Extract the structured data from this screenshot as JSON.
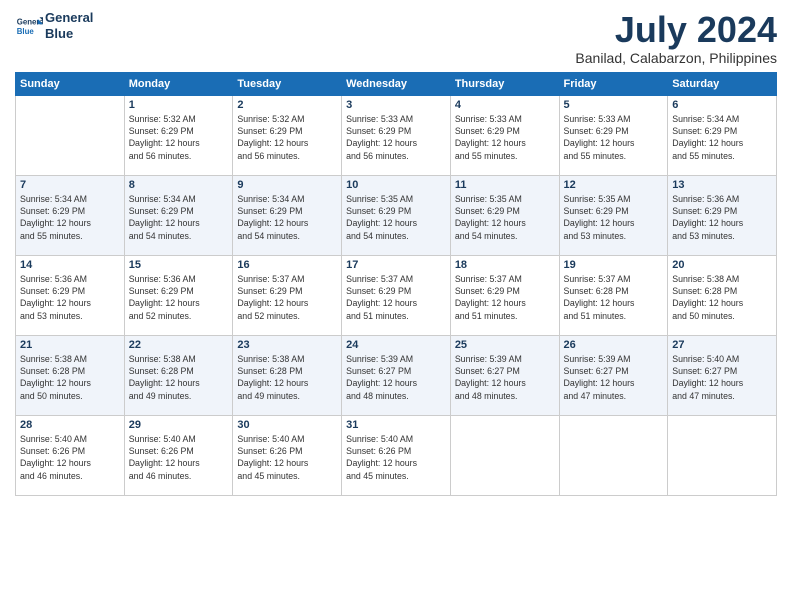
{
  "header": {
    "logo_line1": "General",
    "logo_line2": "Blue",
    "month_year": "July 2024",
    "location": "Banilad, Calabarzon, Philippines"
  },
  "weekdays": [
    "Sunday",
    "Monday",
    "Tuesday",
    "Wednesday",
    "Thursday",
    "Friday",
    "Saturday"
  ],
  "weeks": [
    [
      {
        "day": null,
        "info": null
      },
      {
        "day": "1",
        "info": "Sunrise: 5:32 AM\nSunset: 6:29 PM\nDaylight: 12 hours\nand 56 minutes."
      },
      {
        "day": "2",
        "info": "Sunrise: 5:32 AM\nSunset: 6:29 PM\nDaylight: 12 hours\nand 56 minutes."
      },
      {
        "day": "3",
        "info": "Sunrise: 5:33 AM\nSunset: 6:29 PM\nDaylight: 12 hours\nand 56 minutes."
      },
      {
        "day": "4",
        "info": "Sunrise: 5:33 AM\nSunset: 6:29 PM\nDaylight: 12 hours\nand 55 minutes."
      },
      {
        "day": "5",
        "info": "Sunrise: 5:33 AM\nSunset: 6:29 PM\nDaylight: 12 hours\nand 55 minutes."
      },
      {
        "day": "6",
        "info": "Sunrise: 5:34 AM\nSunset: 6:29 PM\nDaylight: 12 hours\nand 55 minutes."
      }
    ],
    [
      {
        "day": "7",
        "info": "Sunrise: 5:34 AM\nSunset: 6:29 PM\nDaylight: 12 hours\nand 55 minutes."
      },
      {
        "day": "8",
        "info": "Sunrise: 5:34 AM\nSunset: 6:29 PM\nDaylight: 12 hours\nand 54 minutes."
      },
      {
        "day": "9",
        "info": "Sunrise: 5:34 AM\nSunset: 6:29 PM\nDaylight: 12 hours\nand 54 minutes."
      },
      {
        "day": "10",
        "info": "Sunrise: 5:35 AM\nSunset: 6:29 PM\nDaylight: 12 hours\nand 54 minutes."
      },
      {
        "day": "11",
        "info": "Sunrise: 5:35 AM\nSunset: 6:29 PM\nDaylight: 12 hours\nand 54 minutes."
      },
      {
        "day": "12",
        "info": "Sunrise: 5:35 AM\nSunset: 6:29 PM\nDaylight: 12 hours\nand 53 minutes."
      },
      {
        "day": "13",
        "info": "Sunrise: 5:36 AM\nSunset: 6:29 PM\nDaylight: 12 hours\nand 53 minutes."
      }
    ],
    [
      {
        "day": "14",
        "info": "Sunrise: 5:36 AM\nSunset: 6:29 PM\nDaylight: 12 hours\nand 53 minutes."
      },
      {
        "day": "15",
        "info": "Sunrise: 5:36 AM\nSunset: 6:29 PM\nDaylight: 12 hours\nand 52 minutes."
      },
      {
        "day": "16",
        "info": "Sunrise: 5:37 AM\nSunset: 6:29 PM\nDaylight: 12 hours\nand 52 minutes."
      },
      {
        "day": "17",
        "info": "Sunrise: 5:37 AM\nSunset: 6:29 PM\nDaylight: 12 hours\nand 51 minutes."
      },
      {
        "day": "18",
        "info": "Sunrise: 5:37 AM\nSunset: 6:29 PM\nDaylight: 12 hours\nand 51 minutes."
      },
      {
        "day": "19",
        "info": "Sunrise: 5:37 AM\nSunset: 6:28 PM\nDaylight: 12 hours\nand 51 minutes."
      },
      {
        "day": "20",
        "info": "Sunrise: 5:38 AM\nSunset: 6:28 PM\nDaylight: 12 hours\nand 50 minutes."
      }
    ],
    [
      {
        "day": "21",
        "info": "Sunrise: 5:38 AM\nSunset: 6:28 PM\nDaylight: 12 hours\nand 50 minutes."
      },
      {
        "day": "22",
        "info": "Sunrise: 5:38 AM\nSunset: 6:28 PM\nDaylight: 12 hours\nand 49 minutes."
      },
      {
        "day": "23",
        "info": "Sunrise: 5:38 AM\nSunset: 6:28 PM\nDaylight: 12 hours\nand 49 minutes."
      },
      {
        "day": "24",
        "info": "Sunrise: 5:39 AM\nSunset: 6:27 PM\nDaylight: 12 hours\nand 48 minutes."
      },
      {
        "day": "25",
        "info": "Sunrise: 5:39 AM\nSunset: 6:27 PM\nDaylight: 12 hours\nand 48 minutes."
      },
      {
        "day": "26",
        "info": "Sunrise: 5:39 AM\nSunset: 6:27 PM\nDaylight: 12 hours\nand 47 minutes."
      },
      {
        "day": "27",
        "info": "Sunrise: 5:40 AM\nSunset: 6:27 PM\nDaylight: 12 hours\nand 47 minutes."
      }
    ],
    [
      {
        "day": "28",
        "info": "Sunrise: 5:40 AM\nSunset: 6:26 PM\nDaylight: 12 hours\nand 46 minutes."
      },
      {
        "day": "29",
        "info": "Sunrise: 5:40 AM\nSunset: 6:26 PM\nDaylight: 12 hours\nand 46 minutes."
      },
      {
        "day": "30",
        "info": "Sunrise: 5:40 AM\nSunset: 6:26 PM\nDaylight: 12 hours\nand 45 minutes."
      },
      {
        "day": "31",
        "info": "Sunrise: 5:40 AM\nSunset: 6:26 PM\nDaylight: 12 hours\nand 45 minutes."
      },
      {
        "day": null,
        "info": null
      },
      {
        "day": null,
        "info": null
      },
      {
        "day": null,
        "info": null
      }
    ]
  ]
}
